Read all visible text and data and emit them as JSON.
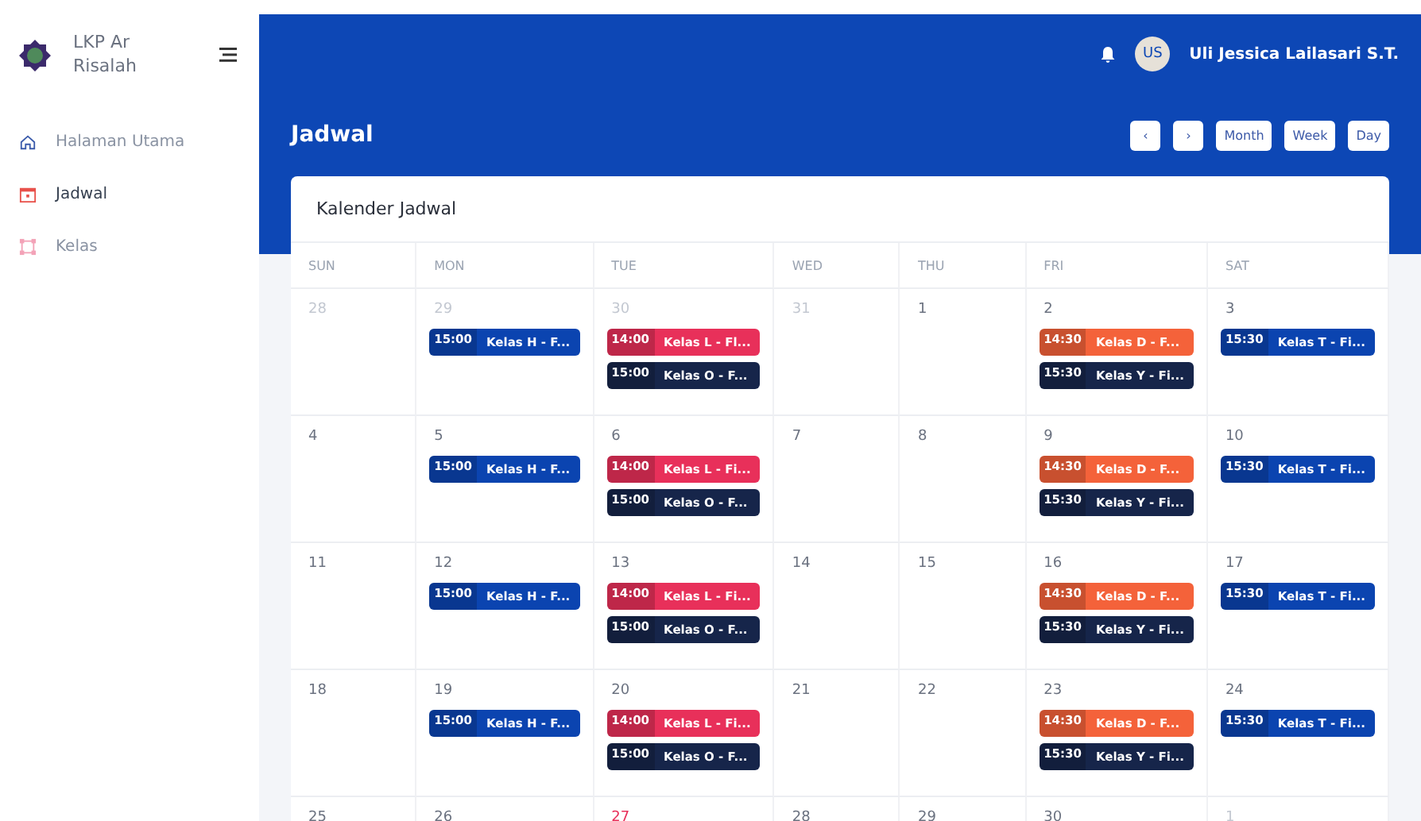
{
  "sidebar": {
    "brand": "LKP Ar Risalah",
    "items": [
      {
        "label": "Halaman Utama",
        "kind": "home",
        "selected": false
      },
      {
        "label": "Jadwal",
        "kind": "calendar",
        "selected": true
      },
      {
        "label": "Kelas",
        "kind": "grid",
        "selected": false
      }
    ]
  },
  "topbar": {
    "avatar_initials": "US",
    "user_name": "Uli Jessica Lailasari S.T."
  },
  "page_title": "Jadwal",
  "nav_buttons": [
    {
      "label": "‹"
    },
    {
      "label": "›"
    }
  ],
  "view_buttons": [
    {
      "label": "Month",
      "selected": false
    },
    {
      "label": "Week",
      "selected": false
    },
    {
      "label": "Day",
      "selected": false
    }
  ],
  "calendar": {
    "title": "Kalender Jadwal",
    "weekdays": [
      "SUN",
      "MON",
      "TUE",
      "WED",
      "THU",
      "FRI",
      "SAT"
    ],
    "weeks": [
      [
        {
          "day": "28",
          "muted": true,
          "today": false
        },
        {
          "day": "29",
          "muted": true,
          "today": false,
          "events": [
            {
              "time": "15:00",
              "title": "Kelas H - F...",
              "color": "#0b44b0"
            }
          ]
        },
        {
          "day": "30",
          "muted": true,
          "today": false,
          "events": [
            {
              "time": "14:00",
              "title": "Kelas L - Fl...",
              "color": "#e8305a"
            },
            {
              "time": "15:00",
              "title": "Kelas O - F...",
              "color": "#16254a"
            }
          ]
        },
        {
          "day": "31",
          "muted": true,
          "today": false
        },
        {
          "day": "1",
          "muted": false,
          "today": false
        },
        {
          "day": "2",
          "muted": false,
          "today": false,
          "events": [
            {
              "time": "14:30",
              "title": "Kelas D - F...",
              "color": "#f4623a"
            },
            {
              "time": "15:30",
              "title": "Kelas Y - Fi...",
              "color": "#16254a"
            }
          ]
        },
        {
          "day": "3",
          "muted": false,
          "today": false,
          "events": [
            {
              "time": "15:30",
              "title": "Kelas T - Fi...",
              "color": "#0b44b0"
            }
          ]
        }
      ],
      [
        {
          "day": "4",
          "muted": false,
          "today": false
        },
        {
          "day": "5",
          "muted": false,
          "today": false,
          "events": [
            {
              "time": "15:00",
              "title": "Kelas H - F...",
              "color": "#0b44b0"
            }
          ]
        },
        {
          "day": "6",
          "muted": false,
          "today": false,
          "events": [
            {
              "time": "14:00",
              "title": "Kelas L - Fi...",
              "color": "#e8305a"
            },
            {
              "time": "15:00",
              "title": "Kelas O - F...",
              "color": "#16254a"
            }
          ]
        },
        {
          "day": "7",
          "muted": false,
          "today": false
        },
        {
          "day": "8",
          "muted": false,
          "today": false
        },
        {
          "day": "9",
          "muted": false,
          "today": false,
          "events": [
            {
              "time": "14:30",
              "title": "Kelas D - F...",
              "color": "#f4623a"
            },
            {
              "time": "15:30",
              "title": "Kelas Y - Fi...",
              "color": "#16254a"
            }
          ]
        },
        {
          "day": "10",
          "muted": false,
          "today": false,
          "events": [
            {
              "time": "15:30",
              "title": "Kelas T - Fi...",
              "color": "#0b44b0"
            }
          ]
        }
      ],
      [
        {
          "day": "11",
          "muted": false,
          "today": false
        },
        {
          "day": "12",
          "muted": false,
          "today": false,
          "events": [
            {
              "time": "15:00",
              "title": "Kelas H - F...",
              "color": "#0b44b0"
            }
          ]
        },
        {
          "day": "13",
          "muted": false,
          "today": false,
          "events": [
            {
              "time": "14:00",
              "title": "Kelas L - Fi...",
              "color": "#e8305a"
            },
            {
              "time": "15:00",
              "title": "Kelas O - F...",
              "color": "#16254a"
            }
          ]
        },
        {
          "day": "14",
          "muted": false,
          "today": false
        },
        {
          "day": "15",
          "muted": false,
          "today": false
        },
        {
          "day": "16",
          "muted": false,
          "today": false,
          "events": [
            {
              "time": "14:30",
              "title": "Kelas D - F...",
              "color": "#f4623a"
            },
            {
              "time": "15:30",
              "title": "Kelas Y - Fi...",
              "color": "#16254a"
            }
          ]
        },
        {
          "day": "17",
          "muted": false,
          "today": false,
          "events": [
            {
              "time": "15:30",
              "title": "Kelas T - Fi...",
              "color": "#0b44b0"
            }
          ]
        }
      ],
      [
        {
          "day": "18",
          "muted": false,
          "today": false
        },
        {
          "day": "19",
          "muted": false,
          "today": false,
          "events": [
            {
              "time": "15:00",
              "title": "Kelas H - F...",
              "color": "#0b44b0"
            }
          ]
        },
        {
          "day": "20",
          "muted": false,
          "today": false,
          "events": [
            {
              "time": "14:00",
              "title": "Kelas L - Fi...",
              "color": "#e8305a"
            },
            {
              "time": "15:00",
              "title": "Kelas O - F...",
              "color": "#16254a"
            }
          ]
        },
        {
          "day": "21",
          "muted": false,
          "today": false
        },
        {
          "day": "22",
          "muted": false,
          "today": false
        },
        {
          "day": "23",
          "muted": false,
          "today": false,
          "events": [
            {
              "time": "14:30",
              "title": "Kelas D - F...",
              "color": "#f4623a"
            },
            {
              "time": "15:30",
              "title": "Kelas Y - Fi...",
              "color": "#16254a"
            }
          ]
        },
        {
          "day": "24",
          "muted": false,
          "today": false,
          "events": [
            {
              "time": "15:30",
              "title": "Kelas T - Fi...",
              "color": "#0b44b0"
            }
          ]
        }
      ],
      [
        {
          "day": "25",
          "muted": false,
          "today": false
        },
        {
          "day": "26",
          "muted": false,
          "today": false
        },
        {
          "day": "27",
          "muted": false,
          "today": true
        },
        {
          "day": "28",
          "muted": false,
          "today": false
        },
        {
          "day": "29",
          "muted": false,
          "today": false
        },
        {
          "day": "30",
          "muted": false,
          "today": false
        },
        {
          "day": "1",
          "muted": true,
          "today": false
        }
      ]
    ]
  }
}
